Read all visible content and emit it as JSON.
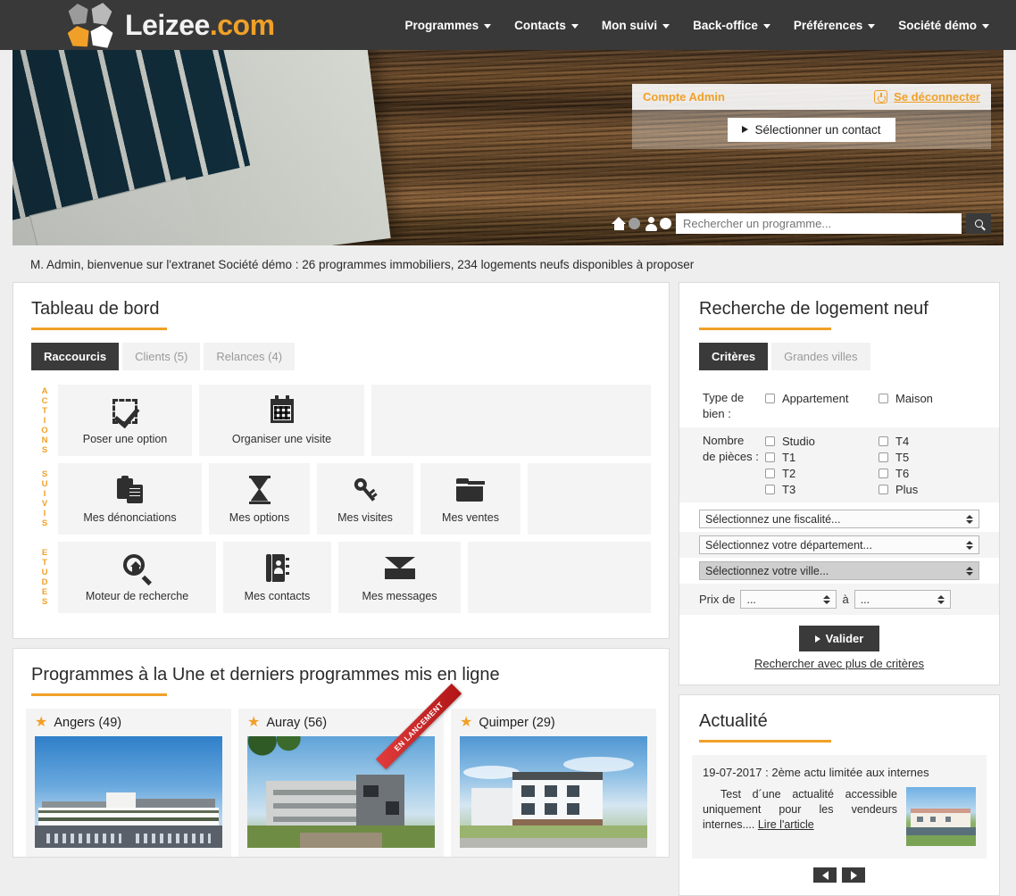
{
  "header": {
    "logo_text_white": "Leizee",
    "logo_text_orange": ".com",
    "nav": [
      {
        "label": "Programmes"
      },
      {
        "label": "Contacts"
      },
      {
        "label": "Mon suivi"
      },
      {
        "label": "Back-office"
      },
      {
        "label": "Préférences"
      },
      {
        "label": "Société démo"
      }
    ]
  },
  "hero": {
    "account_label": "Compte Admin",
    "logout_label": "Se déconnecter",
    "select_contact_label": "Sélectionner un contact",
    "search_placeholder": "Rechercher un programme...",
    "search_value": "",
    "toggle_house_state": "off",
    "toggle_person_state": "on"
  },
  "welcome": {
    "text": "M. Admin, bienvenue sur l'extranet Société démo : 26 programmes immobiliers, 234 logements neufs disponibles à proposer"
  },
  "dashboard": {
    "title": "Tableau de bord",
    "tabs": [
      {
        "label": "Raccourcis",
        "active": true
      },
      {
        "label": "Clients (5)",
        "active": false
      },
      {
        "label": "Relances (4)",
        "active": false
      }
    ],
    "groups": [
      {
        "name": "ACTIONS",
        "items": [
          {
            "label": "Poser une option",
            "icon": "checkbox-check-icon"
          },
          {
            "label": "Organiser une visite",
            "icon": "calendar-icon"
          },
          {
            "label": "",
            "icon": ""
          }
        ]
      },
      {
        "name": "SUIVIS",
        "items": [
          {
            "label": "Mes dénonciations",
            "icon": "clipboard-copy-icon"
          },
          {
            "label": "Mes options",
            "icon": "hourglass-icon"
          },
          {
            "label": "Mes visites",
            "icon": "key-icon"
          },
          {
            "label": "Mes ventes",
            "icon": "folder-icon"
          },
          {
            "label": "",
            "icon": ""
          }
        ]
      },
      {
        "name": "ETUDES",
        "items": [
          {
            "label": "Moteur de recherche",
            "icon": "search-house-icon"
          },
          {
            "label": "Mes contacts",
            "icon": "address-book-icon"
          },
          {
            "label": "Mes messages",
            "icon": "envelope-icon"
          },
          {
            "label": "",
            "icon": ""
          }
        ]
      }
    ]
  },
  "programmes": {
    "title": "Programmes à la Une et derniers programmes mis en ligne",
    "cards": [
      {
        "name": "Angers (49)",
        "ribbon": ""
      },
      {
        "name": "Auray (56)",
        "ribbon": "EN LANCEMENT"
      },
      {
        "name": "Quimper (29)",
        "ribbon": ""
      }
    ]
  },
  "search_panel": {
    "title": "Recherche de logement neuf",
    "tabs": [
      {
        "label": "Critères",
        "active": true
      },
      {
        "label": "Grandes villes",
        "active": false
      }
    ],
    "type_label": "Type de bien :",
    "type_options_left": [
      "Appartement"
    ],
    "type_options_right": [
      "Maison"
    ],
    "rooms_label_line1": "Nombre",
    "rooms_label_line2": "de pièces :",
    "rooms_left": [
      "Studio",
      "T1",
      "T2",
      "T3"
    ],
    "rooms_right": [
      "T4",
      "T5",
      "T6",
      "Plus"
    ],
    "select_fiscalite": "Sélectionnez une fiscalité...",
    "select_departement": "Sélectionnez votre département...",
    "select_ville": "Sélectionnez votre ville...",
    "price_label": "Prix de",
    "price_from": "...",
    "price_to_label": "à",
    "price_to": "...",
    "submit_label": "Valider",
    "more_criteria_label": "Rechercher avec plus de critères"
  },
  "actualite": {
    "title": "Actualité",
    "date_title": "19-07-2017 : 2ème actu limitée aux internes",
    "excerpt": "Test d´une actualité accessible uniquement pour les vendeurs internes....",
    "read_more": "Lire l'article",
    "prev_label": "◀",
    "next_label": "▶"
  },
  "colors": {
    "accent": "#f0a028",
    "dark": "#393939",
    "page_bg": "#eeeeee",
    "ribbon_red": "#c01c1c"
  }
}
